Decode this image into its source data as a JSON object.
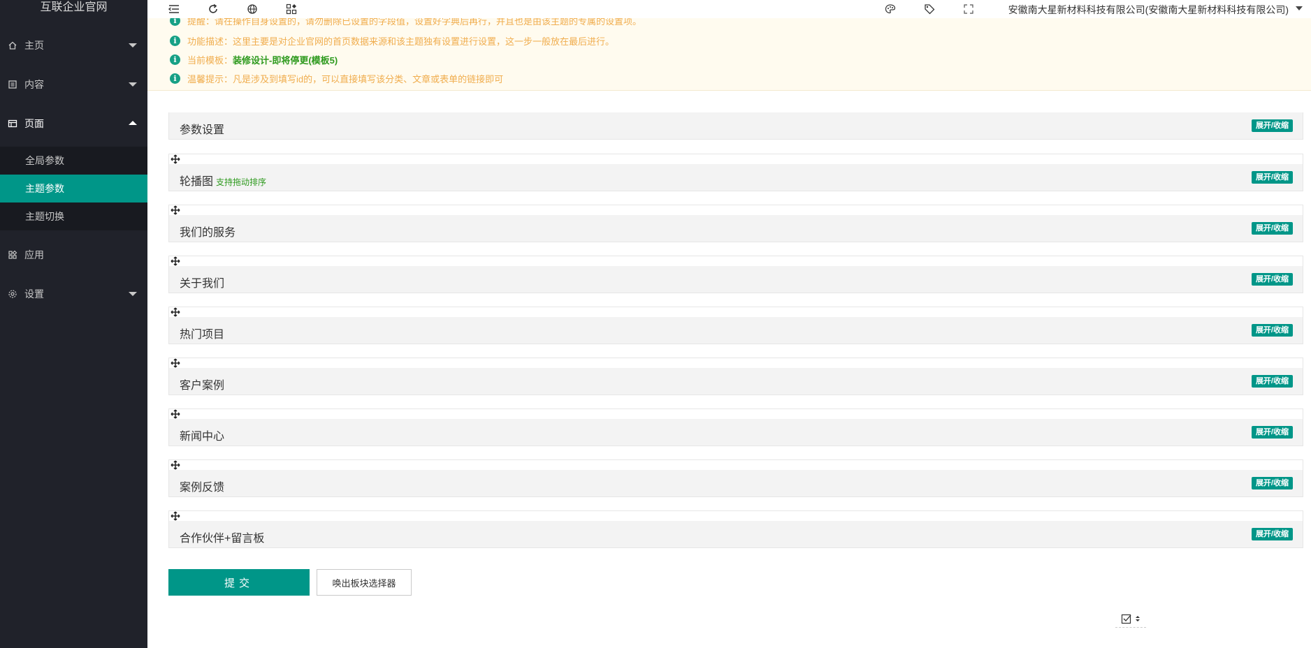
{
  "app": {
    "title": "互联企业官网"
  },
  "sidebar": {
    "items": [
      {
        "label": "主页",
        "icon": "home-icon"
      },
      {
        "label": "内容",
        "icon": "content-icon"
      },
      {
        "label": "页面",
        "icon": "page-icon"
      },
      {
        "label": "应用",
        "icon": "apps-icon"
      },
      {
        "label": "设置",
        "icon": "gear-icon"
      }
    ],
    "sub_items": [
      {
        "label": "全局参数"
      },
      {
        "label": "主题参数"
      },
      {
        "label": "主题切换"
      }
    ],
    "active_sub_item": "主题参数",
    "accent_color": "#009688",
    "background_color": "#20222a"
  },
  "header": {
    "company": "安徽南大星新材料科技有限公司(安徽南大星新材料科技有限公司)",
    "icons": [
      "menu-toggle-icon",
      "refresh-icon",
      "globe-icon",
      "apps-add-icon",
      "palette-icon",
      "tag-icon",
      "fullscreen-icon"
    ]
  },
  "notice": {
    "line1": "提醒：请在操作自身设置的，请勿删除已设置的字段值，设置好字典后再行，并且也是由该主题的专属的设置项。",
    "line2": "功能描述：这里主要是对企业官网的首页数据来源和该主题独有设置进行设置，这一步一般放在最后进行。",
    "line3_prefix": "当前模板：",
    "line3_template": "装修设计-即将停更(模板5)",
    "line4": "温馨提示：凡是涉及到填写id的，可以直接填写该分类、文章或表单的链接即可",
    "text_color": "#f0ad4e"
  },
  "panels": [
    {
      "title": "参数设置",
      "note": "",
      "toggle": "展开/收缩"
    },
    {
      "title": "轮播图",
      "note": "支持拖动排序",
      "toggle": "展开/收缩"
    },
    {
      "title": "我们的服务",
      "note": "",
      "toggle": "展开/收缩"
    },
    {
      "title": "关于我们",
      "note": "",
      "toggle": "展开/收缩"
    },
    {
      "title": "热门项目",
      "note": "",
      "toggle": "展开/收缩"
    },
    {
      "title": "客户案例",
      "note": "",
      "toggle": "展开/收缩"
    },
    {
      "title": "新闻中心",
      "note": "",
      "toggle": "展开/收缩"
    },
    {
      "title": "案例反馈",
      "note": "",
      "toggle": "展开/收缩"
    },
    {
      "title": "合作伙伴+留言板",
      "note": "",
      "toggle": "展开/收缩"
    }
  ],
  "actions": {
    "submit": "提交",
    "picker": "唤出板块选择器"
  }
}
